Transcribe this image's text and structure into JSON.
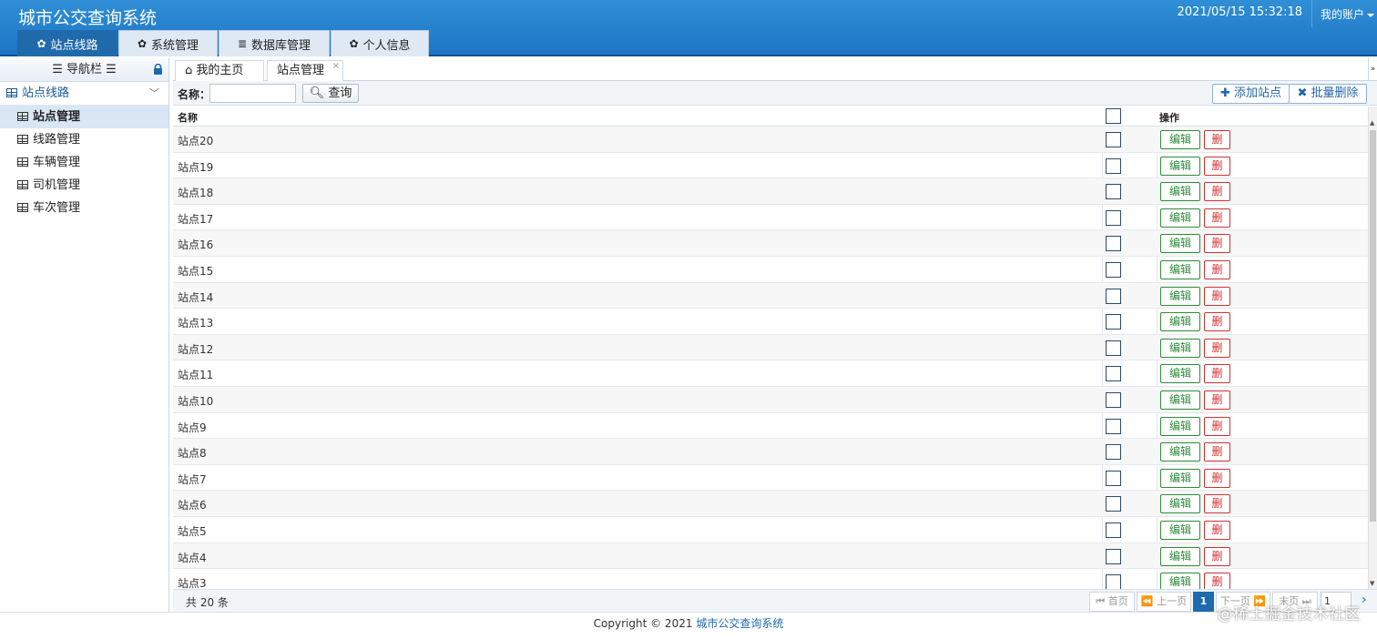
{
  "app": {
    "title": "城市公交查询系统",
    "datetime": "2021/05/15 15:32:18",
    "account_label": "我的账户"
  },
  "topnav": [
    {
      "label": "站点线路",
      "icon": "gear-icon",
      "active": true
    },
    {
      "label": "系统管理",
      "icon": "gear-icon",
      "active": false
    },
    {
      "label": "数据库管理",
      "icon": "database-icon",
      "active": false
    },
    {
      "label": "个人信息",
      "icon": "gear-icon",
      "active": false
    }
  ],
  "sidebar": {
    "header": "导航栏",
    "group": "站点线路",
    "items": [
      {
        "label": "站点管理",
        "active": true
      },
      {
        "label": "线路管理",
        "active": false
      },
      {
        "label": "车辆管理",
        "active": false
      },
      {
        "label": "司机管理",
        "active": false
      },
      {
        "label": "车次管理",
        "active": false
      }
    ]
  },
  "page_tabs": {
    "home": "我的主页",
    "current": "站点管理",
    "close": "×"
  },
  "toolbar": {
    "name_label": "名称：",
    "name_value": "",
    "query_label": "查询",
    "add_label": "添加站点",
    "batch_delete_label": "批量删除"
  },
  "grid": {
    "col_name": "名称",
    "col_ops": "操作",
    "edit_label": "编辑",
    "delete_label": "删",
    "rows": [
      "站点20",
      "站点19",
      "站点18",
      "站点17",
      "站点16",
      "站点15",
      "站点14",
      "站点13",
      "站点12",
      "站点11",
      "站点10",
      "站点9",
      "站点8",
      "站点7",
      "站点6",
      "站点5",
      "站点4",
      "站点3"
    ]
  },
  "pager": {
    "total": "共 20 条",
    "first": "首页",
    "prev": "上一页",
    "current": "1",
    "next": "下一页",
    "last": "末页",
    "page_input": "1"
  },
  "footer": {
    "copyright": "Copyright © 2021",
    "link": "城市公交查询系统"
  },
  "watermark": "@稀土掘金技术社区"
}
